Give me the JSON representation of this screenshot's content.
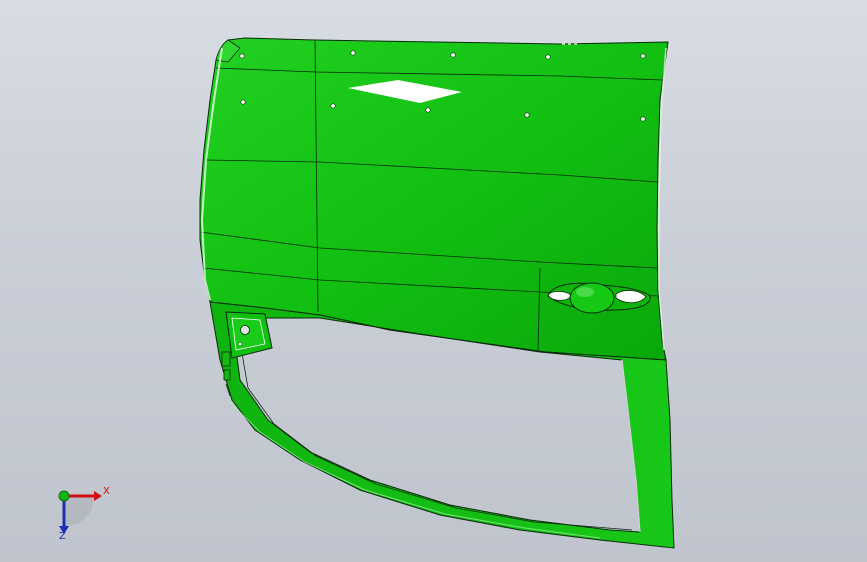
{
  "viewport": {
    "background_top": "#d8dce3",
    "background_bottom": "#bfc4cd"
  },
  "model": {
    "part": "door-panel",
    "body_color": "#11c411",
    "highlight_color": "#ffffff",
    "edge_color": "#0a2a0a"
  },
  "triad": {
    "x_label": "X",
    "z_label": "Z",
    "x_color": "#d01010",
    "y_color": "#14b414",
    "z_color": "#1a2fb0"
  }
}
